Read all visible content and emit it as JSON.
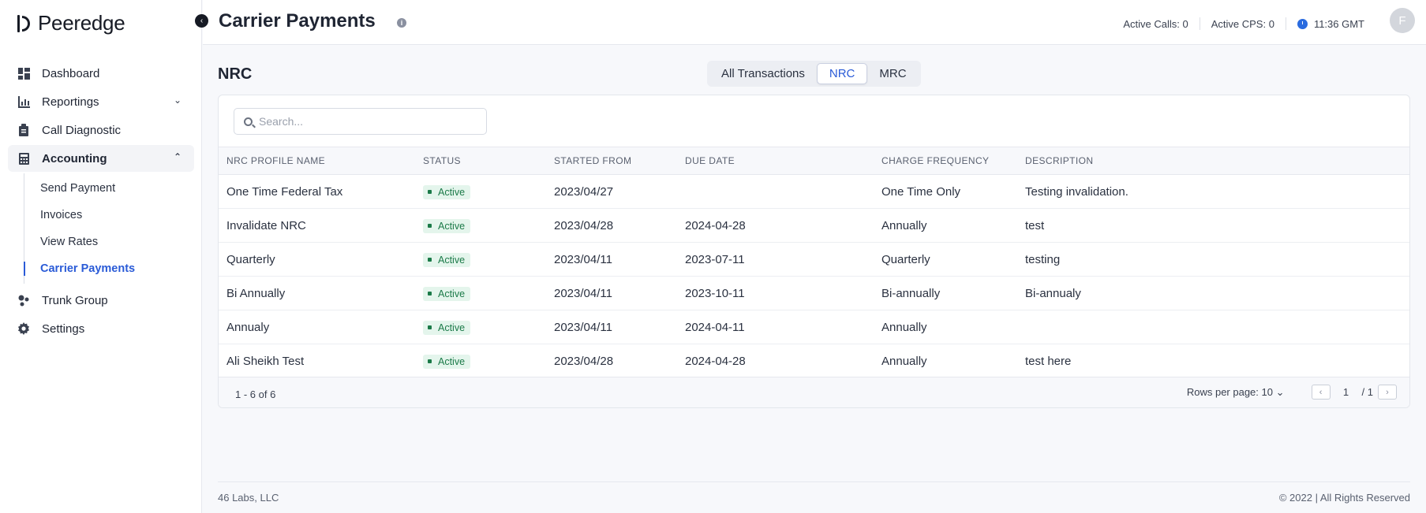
{
  "app": {
    "name": "Peeredge"
  },
  "sidebar": {
    "items": [
      {
        "label": "Dashboard"
      },
      {
        "label": "Reportings"
      },
      {
        "label": "Call Diagnostic"
      },
      {
        "label": "Accounting"
      }
    ],
    "accounting_sub": [
      {
        "label": "Send Payment"
      },
      {
        "label": "Invoices"
      },
      {
        "label": "View Rates"
      },
      {
        "label": "Carrier Payments"
      }
    ],
    "bottom_items": [
      {
        "label": "Trunk Group"
      },
      {
        "label": "Settings"
      }
    ]
  },
  "header": {
    "title": "Carrier Payments",
    "active_calls": "Active Calls: 0",
    "active_cps": "Active CPS: 0",
    "time": "11:36 GMT",
    "avatar_initial": "F"
  },
  "section": {
    "title": "NRC"
  },
  "tabs": [
    {
      "label": "All Transactions"
    },
    {
      "label": "NRC"
    },
    {
      "label": "MRC"
    }
  ],
  "search": {
    "placeholder": "Search...",
    "value": ""
  },
  "table": {
    "columns": [
      "NRC PROFILE NAME",
      "STATUS",
      "STARTED FROM",
      "DUE DATE",
      "CHARGE FREQUENCY",
      "DESCRIPTION"
    ],
    "rows": [
      {
        "name": "One Time Federal Tax",
        "status": "Active",
        "started": "2023/04/27",
        "due": "",
        "frequency": "One Time Only",
        "description": "Testing invalidation."
      },
      {
        "name": "Invalidate NRC",
        "status": "Active",
        "started": "2023/04/28",
        "due": "2024-04-28",
        "frequency": "Annually",
        "description": "test"
      },
      {
        "name": "Quarterly",
        "status": "Active",
        "started": "2023/04/11",
        "due": "2023-07-11",
        "frequency": "Quarterly",
        "description": "testing"
      },
      {
        "name": "Bi Annually",
        "status": "Active",
        "started": "2023/04/11",
        "due": "2023-10-11",
        "frequency": "Bi-annually",
        "description": "Bi-annualy"
      },
      {
        "name": "Annualy",
        "status": "Active",
        "started": "2023/04/11",
        "due": "2024-04-11",
        "frequency": "Annually",
        "description": ""
      },
      {
        "name": "Ali Sheikh Test",
        "status": "Active",
        "started": "2023/04/28",
        "due": "2024-04-28",
        "frequency": "Annually",
        "description": "test here"
      }
    ]
  },
  "pagination": {
    "range": "1 - 6 of 6",
    "rows_per_page_label": "Rows per page:",
    "rows_per_page": "10",
    "current_page": "1",
    "total_pages": "/ 1"
  },
  "footer": {
    "company": "46 Labs, LLC",
    "copyright": "© 2022 | All Rights Reserved"
  },
  "colors": {
    "accent": "#2a5bd7",
    "active_badge_bg": "#e4f5ec",
    "active_badge_text": "#1b7a48"
  }
}
